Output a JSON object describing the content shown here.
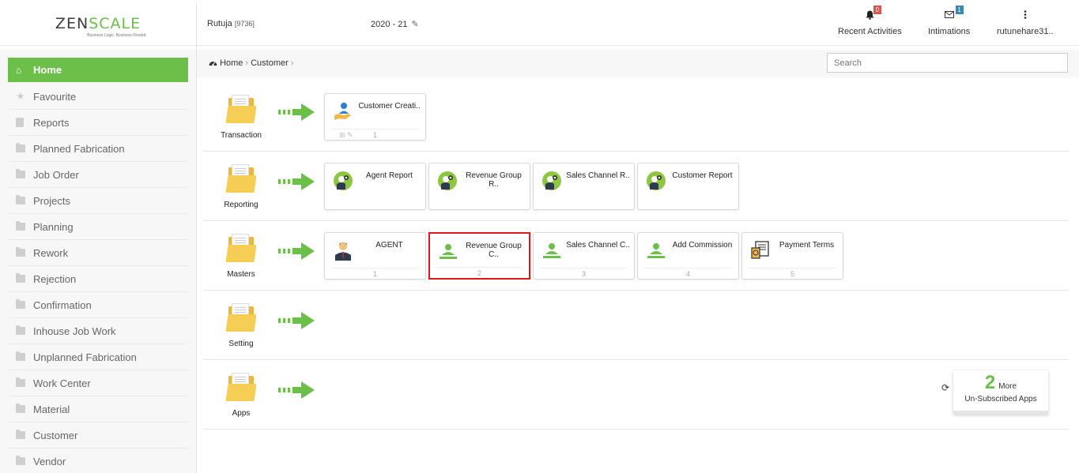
{
  "brand": {
    "logo_left": "ZEN",
    "logo_mid": "SC",
    "logo_o": "A",
    "logo_right": "LE",
    "tagline": "Business Logic. Business Rooted."
  },
  "header": {
    "user_name": "Rutuja",
    "user_code": "[9736]",
    "fiscal_year": "2020 - 21",
    "recent_activities": {
      "label": "Recent Activities",
      "count": "0"
    },
    "intimations": {
      "label": "Intimations",
      "count": "1"
    },
    "account": {
      "label": "rutunehare31.."
    }
  },
  "breadcrumb": {
    "home": "Home",
    "current": "Customer"
  },
  "search": {
    "placeholder": "Search"
  },
  "sidebar": {
    "items": [
      {
        "label": "Home"
      },
      {
        "label": "Favourite"
      },
      {
        "label": "Reports"
      },
      {
        "label": "Planned Fabrication"
      },
      {
        "label": "Job Order"
      },
      {
        "label": "Projects"
      },
      {
        "label": "Planning"
      },
      {
        "label": "Rework"
      },
      {
        "label": "Rejection"
      },
      {
        "label": "Confirmation"
      },
      {
        "label": "Inhouse Job Work"
      },
      {
        "label": "Unplanned Fabrication"
      },
      {
        "label": "Work Center"
      },
      {
        "label": "Material"
      },
      {
        "label": "Customer"
      },
      {
        "label": "Vendor"
      }
    ]
  },
  "sections": {
    "transaction": {
      "label": "Transaction",
      "tiles": [
        {
          "name": "Customer Creati..",
          "num": "1"
        }
      ]
    },
    "reporting": {
      "label": "Reporting",
      "tiles": [
        {
          "name": "Agent Report"
        },
        {
          "name": "Revenue Group R.."
        },
        {
          "name": "Sales Channel R.."
        },
        {
          "name": "Customer Report"
        }
      ]
    },
    "masters": {
      "label": "Masters",
      "tiles": [
        {
          "name": "AGENT",
          "num": "1"
        },
        {
          "name": "Revenue Group C..",
          "num": "2"
        },
        {
          "name": "Sales Channel C..",
          "num": "3"
        },
        {
          "name": "Add Commission",
          "num": "4"
        },
        {
          "name": "Payment Terms",
          "num": "5"
        }
      ]
    },
    "setting": {
      "label": "Setting"
    },
    "apps": {
      "label": "Apps"
    }
  },
  "unsubscribed": {
    "count": "2",
    "more": "More",
    "label": "Un-Subscribed Apps"
  },
  "colors": {
    "accent": "#6cc04a",
    "selected_border": "#e0181b",
    "folder": "#f6ce55"
  }
}
